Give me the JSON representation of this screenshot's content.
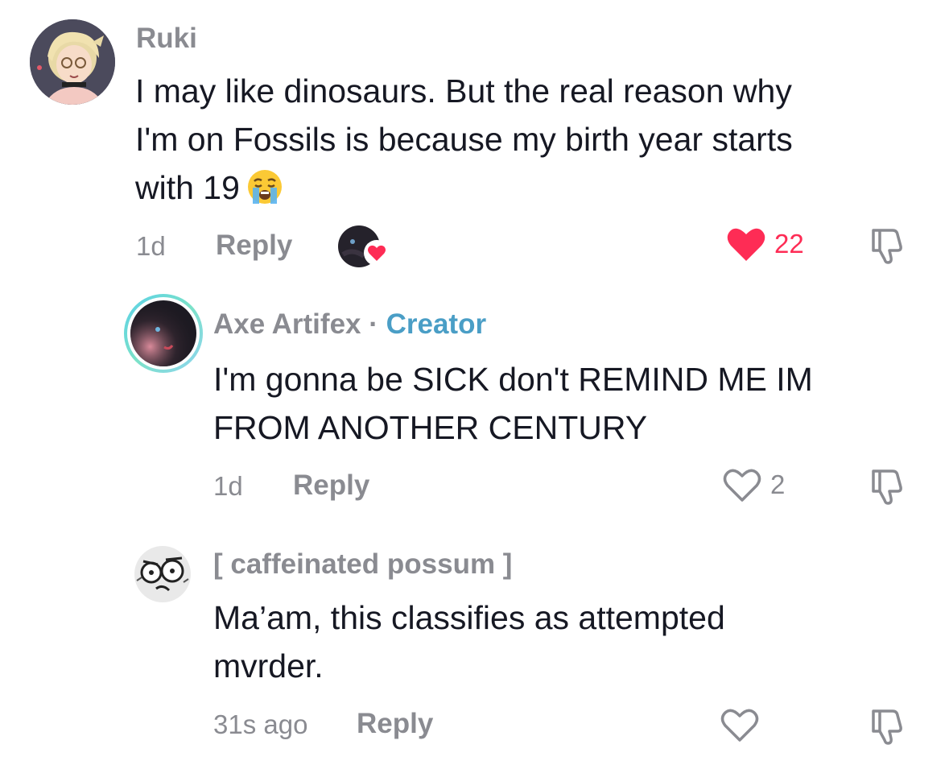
{
  "comments": [
    {
      "username": "Ruki",
      "text_line1": "I may like dinosaurs. But the real reason why",
      "text_line2": "I'm on Fossils is because my birth year starts",
      "text_line3": "with 19",
      "emoji": "loudly-crying-face",
      "time": "1d",
      "reply_label": "Reply",
      "likes": "22",
      "liked": true,
      "creator_liked": true
    },
    {
      "username": "Axe Artifex",
      "separator": " · ",
      "creator_label": "Creator",
      "text_line1": "I'm gonna be SICK don't REMIND ME IM",
      "text_line2": "FROM ANOTHER CENTURY",
      "time": "1d",
      "reply_label": "Reply",
      "likes": "2",
      "liked": false
    },
    {
      "username": "[ caffeinated possum ]",
      "text_line1": "Ma’am, this classifies as attempted",
      "text_line2": "mvrder.",
      "time": "31s ago",
      "reply_label": "Reply",
      "likes": "",
      "liked": false
    }
  ],
  "colors": {
    "like_red": "#fe2c55",
    "muted_gray": "#8a8b91",
    "creator_blue": "#4a9ec6",
    "text_dark": "#161823"
  },
  "icons": [
    "heart-filled-icon",
    "heart-outline-icon",
    "dislike-icon",
    "creator-liked-badge-icon"
  ]
}
